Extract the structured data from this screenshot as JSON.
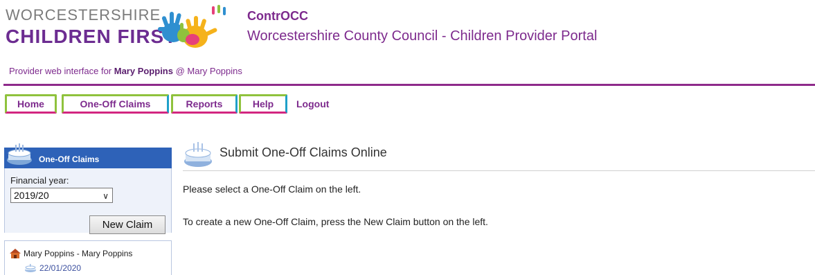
{
  "logo": {
    "line1": "WORCESTERSHIRE",
    "line2": "CHILDREN FIRST"
  },
  "header": {
    "app_name": "ContrOCC",
    "subtitle": "Worcestershire County Council - Children Provider Portal",
    "provider_prefix": "Provider web interface for ",
    "provider_name": "Mary Poppins",
    "provider_suffix": " @ Mary Poppins"
  },
  "nav": {
    "home": "Home",
    "one_off_claims": "One-Off Claims",
    "reports": "Reports",
    "help": "Help",
    "logout": "Logout"
  },
  "sidebar": {
    "title": "One-Off Claims",
    "financial_year_label": "Financial year:",
    "financial_year_value": "2019/20",
    "new_claim_label": "New Claim",
    "tree": {
      "provider": "Mary Poppins - Mary Poppins",
      "date": "22/01/2020"
    }
  },
  "main": {
    "title": "Submit One-Off Claims Online",
    "line1": "Please select a One-Off Claim on the left.",
    "line2": "To create a new One-Off Claim, press the New Claim button on the left."
  },
  "colors": {
    "brand_purple": "#7d2a8d",
    "nav_green": "#8fc23d",
    "nav_pink": "#d22680",
    "nav_blue": "#1fa0c9",
    "sidebar_blue": "#2e62b8"
  }
}
